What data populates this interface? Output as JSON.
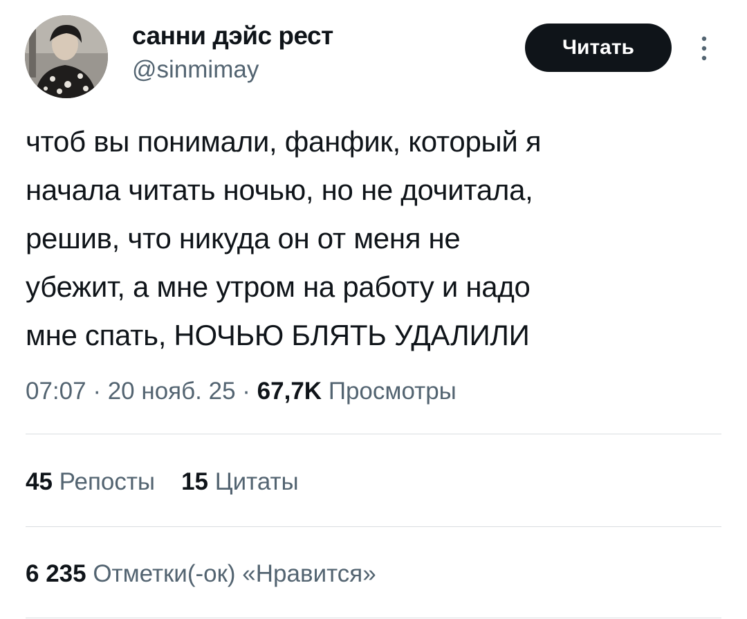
{
  "author": {
    "display_name": "санни дэйс рест",
    "handle": "@sinmimay"
  },
  "follow_button_label": "Читать",
  "tweet": {
    "text": "чтоб вы понимали, фанфик, который я\nначала читать ночью, но не дочитала,\nрешив, что никуда он от меня не\nубежит, а мне утром на работу и надо\nмне спать,  НОЧЬЮ БЛЯТЬ УДАЛИЛИ"
  },
  "meta": {
    "time": "07:07",
    "separator": "·",
    "date": "20 нояб. 25",
    "views_count": "67,7K",
    "views_label": "Просмотры"
  },
  "stats": {
    "reposts_count": "45",
    "reposts_label": "Репосты",
    "quotes_count": "15",
    "quotes_label": "Цитаты",
    "likes_count": "6 235",
    "likes_label": "Отметки(-ок) «Нравится»"
  },
  "icons": {
    "more": "more-vertical-icon"
  },
  "colors": {
    "text": "#0f1419",
    "secondary": "#536471",
    "button_bg": "#0f1419",
    "divider": "#d9dde0"
  }
}
